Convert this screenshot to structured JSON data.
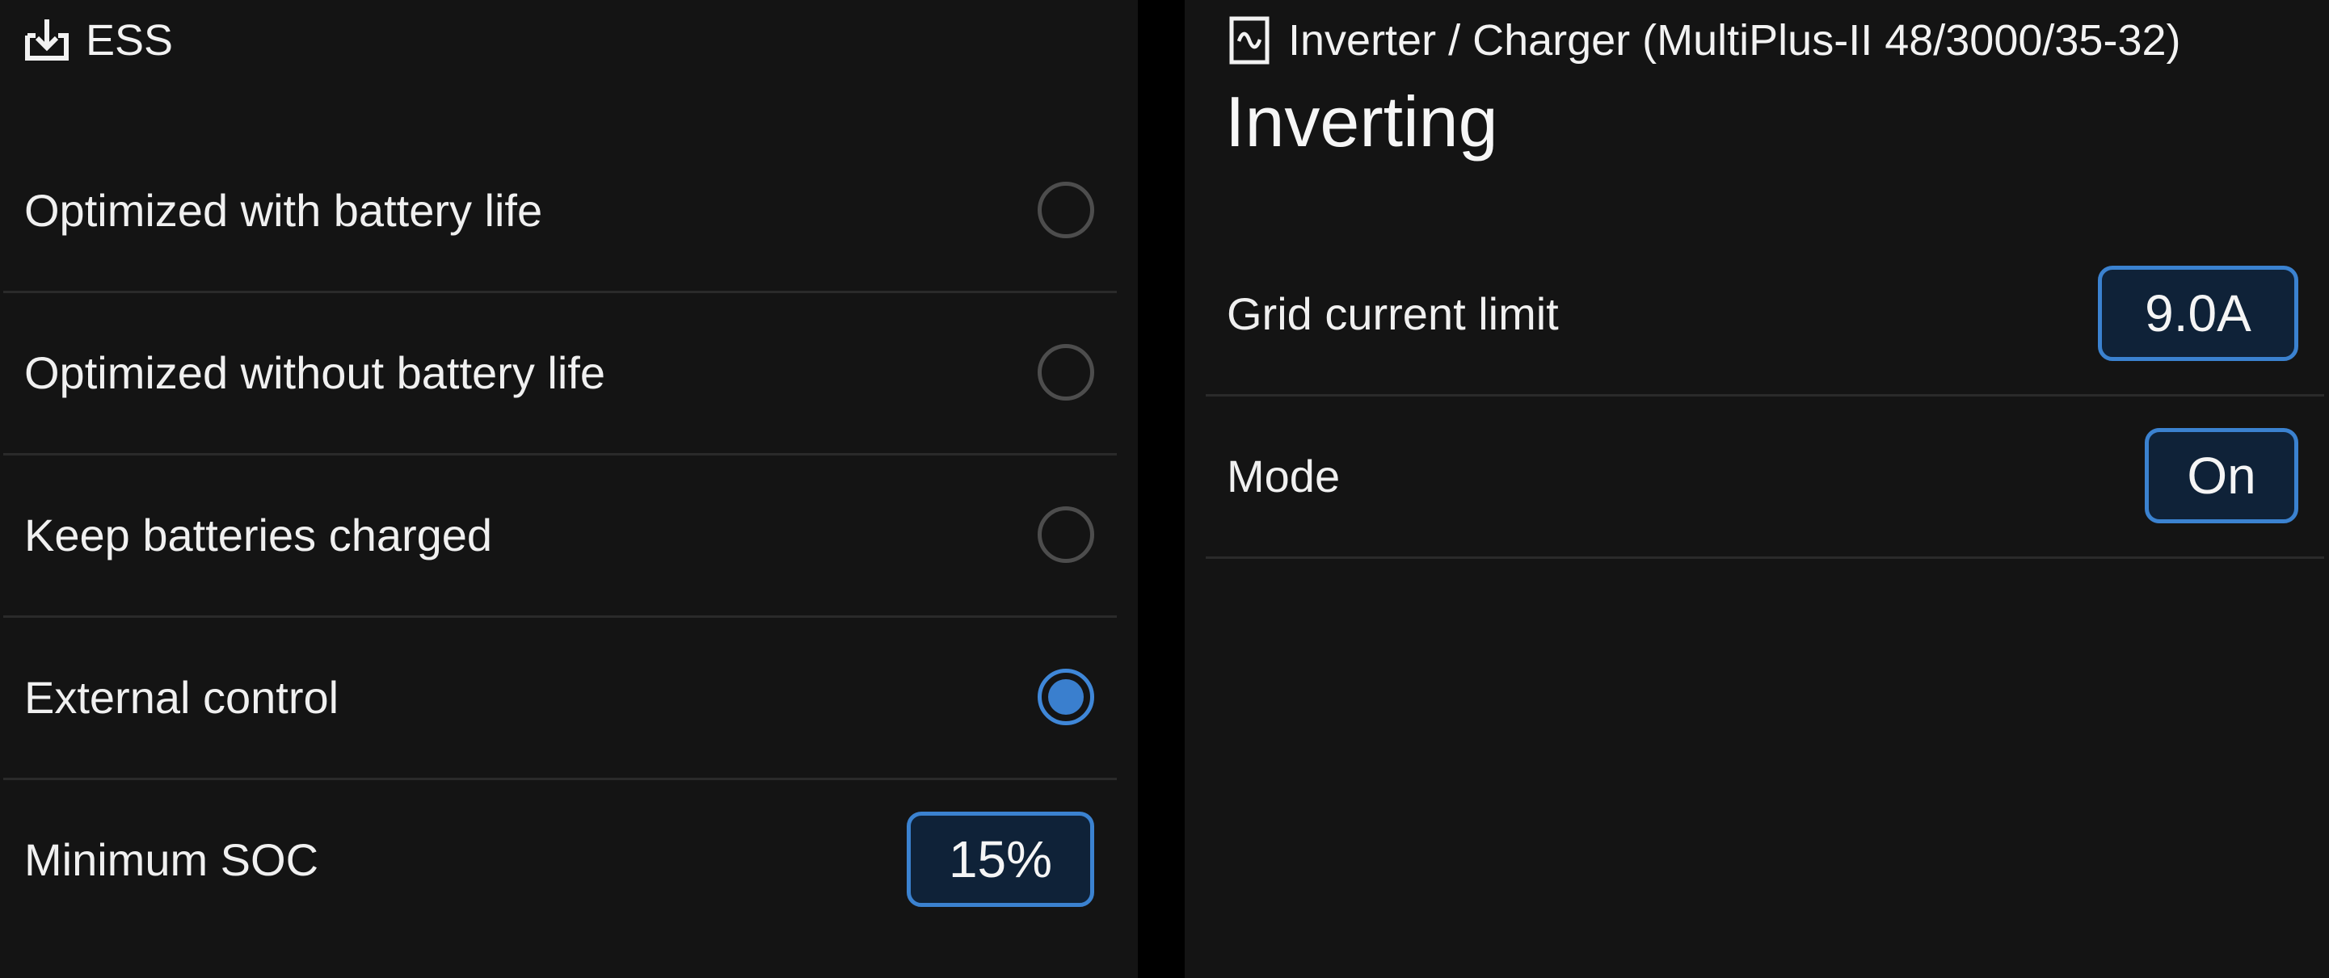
{
  "ess": {
    "title": "ESS",
    "icon": "download-tray-icon",
    "modes": [
      {
        "label": "Optimized with battery life",
        "selected": false
      },
      {
        "label": "Optimized without battery life",
        "selected": false
      },
      {
        "label": "Keep batteries charged",
        "selected": false
      },
      {
        "label": "External control",
        "selected": true
      }
    ],
    "minimum_soc": {
      "label": "Minimum SOC",
      "value": "15%"
    }
  },
  "inverter": {
    "title": "Inverter / Charger (MultiPlus-II 48/3000/35-32)",
    "icon": "inverter-wave-icon",
    "status": "Inverting",
    "grid_current_limit": {
      "label": "Grid current limit",
      "value": "9.0A"
    },
    "mode": {
      "label": "Mode",
      "value": "On"
    }
  },
  "colors": {
    "background": "#141414",
    "accent": "#3b82d0",
    "value_fill": "#0f2238",
    "radio_unselected": "#4d4d4d",
    "divider": "#2a2a2a"
  }
}
